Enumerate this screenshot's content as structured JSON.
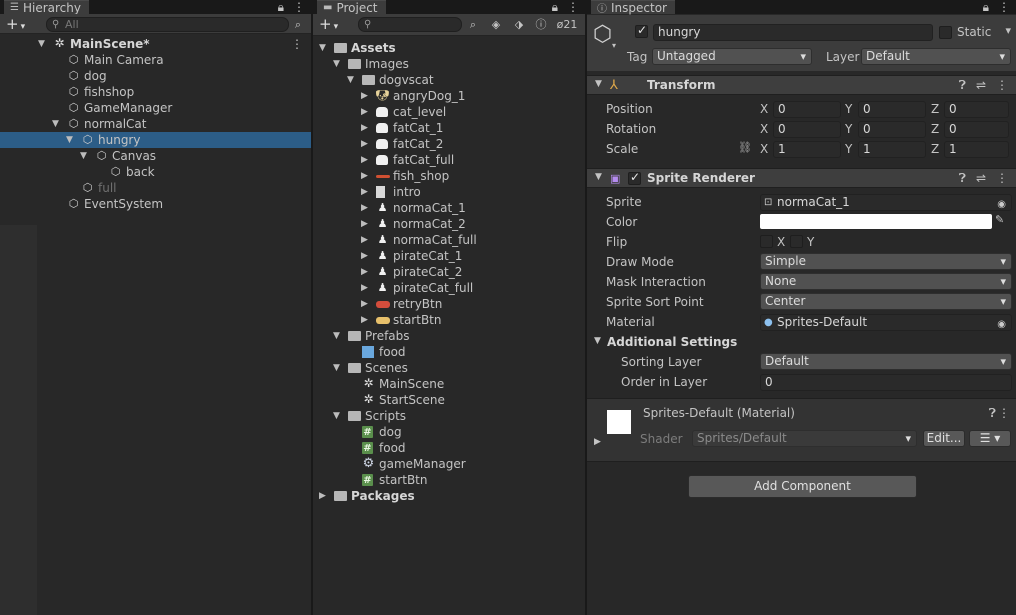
{
  "hierarchy": {
    "tab_label": "Hierarchy",
    "search_placeholder": "All",
    "items": [
      {
        "label": "MainScene*",
        "depth": 0,
        "icon": "unity-scene-icon",
        "bold": true,
        "arrow": "down",
        "kebab": true
      },
      {
        "label": "Main Camera",
        "depth": 1,
        "icon": "gameobject-cube-icon"
      },
      {
        "label": "dog",
        "depth": 1,
        "icon": "gameobject-cube-icon"
      },
      {
        "label": "fishshop",
        "depth": 1,
        "icon": "gameobject-cube-icon"
      },
      {
        "label": "GameManager",
        "depth": 1,
        "icon": "gameobject-cube-icon"
      },
      {
        "label": "normalCat",
        "depth": 1,
        "icon": "gameobject-cube-icon",
        "arrow": "down"
      },
      {
        "label": "hungry",
        "depth": 2,
        "icon": "gameobject-cube-icon",
        "arrow": "down",
        "selected": true
      },
      {
        "label": "Canvas",
        "depth": 3,
        "icon": "gameobject-cube-icon",
        "arrow": "down"
      },
      {
        "label": "back",
        "depth": 4,
        "icon": "gameobject-cube-icon"
      },
      {
        "label": "full",
        "depth": 2,
        "icon": "gameobject-cube-icon",
        "inactive": true
      },
      {
        "label": "EventSystem",
        "depth": 1,
        "icon": "gameobject-cube-icon"
      }
    ]
  },
  "project": {
    "tab_label": "Project",
    "hidden_count": "21",
    "items": [
      {
        "label": "Assets",
        "depth": 0,
        "icon": "folder-icon",
        "bold": true,
        "arrow": "down"
      },
      {
        "label": "Images",
        "depth": 1,
        "icon": "folder-icon",
        "arrow": "down"
      },
      {
        "label": "dogvscat",
        "depth": 2,
        "icon": "folder-icon",
        "arrow": "down"
      },
      {
        "label": "angryDog_1",
        "depth": 3,
        "icon": "sprite-dog-thumb",
        "arrow": "right"
      },
      {
        "label": "cat_level",
        "depth": 3,
        "icon": "sprite-white-thumb",
        "arrow": "right"
      },
      {
        "label": "fatCat_1",
        "depth": 3,
        "icon": "sprite-white-thumb",
        "arrow": "right"
      },
      {
        "label": "fatCat_2",
        "depth": 3,
        "icon": "sprite-white-thumb",
        "arrow": "right"
      },
      {
        "label": "fatCat_full",
        "depth": 3,
        "icon": "sprite-white-thumb",
        "arrow": "right"
      },
      {
        "label": "fish_shop",
        "depth": 3,
        "icon": "sprite-bar-thumb",
        "arrow": "right"
      },
      {
        "label": "intro",
        "depth": 3,
        "icon": "sprite-card-thumb",
        "arrow": "right"
      },
      {
        "label": "normaCat_1",
        "depth": 3,
        "icon": "sprite-cat-thumb",
        "arrow": "right"
      },
      {
        "label": "normaCat_2",
        "depth": 3,
        "icon": "sprite-cat-thumb",
        "arrow": "right"
      },
      {
        "label": "normaCat_full",
        "depth": 3,
        "icon": "sprite-cat-thumb",
        "arrow": "right"
      },
      {
        "label": "pirateCat_1",
        "depth": 3,
        "icon": "sprite-cat-thumb",
        "arrow": "right"
      },
      {
        "label": "pirateCat_2",
        "depth": 3,
        "icon": "sprite-cat-thumb",
        "arrow": "right"
      },
      {
        "label": "pirateCat_full",
        "depth": 3,
        "icon": "sprite-cat-thumb",
        "arrow": "right"
      },
      {
        "label": "retryBtn",
        "depth": 3,
        "icon": "sprite-red-button-thumb",
        "arrow": "right"
      },
      {
        "label": "startBtn",
        "depth": 3,
        "icon": "sprite-yellow-button-thumb",
        "arrow": "right"
      },
      {
        "label": "Prefabs",
        "depth": 1,
        "icon": "folder-icon",
        "arrow": "down"
      },
      {
        "label": "food",
        "depth": 2,
        "icon": "prefab-icon"
      },
      {
        "label": "Scenes",
        "depth": 1,
        "icon": "folder-icon",
        "arrow": "down"
      },
      {
        "label": "MainScene",
        "depth": 2,
        "icon": "unity-scene-icon"
      },
      {
        "label": "StartScene",
        "depth": 2,
        "icon": "unity-scene-icon"
      },
      {
        "label": "Scripts",
        "depth": 1,
        "icon": "folder-icon",
        "arrow": "down"
      },
      {
        "label": "dog",
        "depth": 2,
        "icon": "csharp-script-icon"
      },
      {
        "label": "food",
        "depth": 2,
        "icon": "csharp-script-icon"
      },
      {
        "label": "gameManager",
        "depth": 2,
        "icon": "gear-script-icon"
      },
      {
        "label": "startBtn",
        "depth": 2,
        "icon": "csharp-script-icon"
      },
      {
        "label": "Packages",
        "depth": 0,
        "icon": "folder-icon",
        "bold": true,
        "arrow": "right"
      }
    ]
  },
  "inspector": {
    "tab_label": "Inspector",
    "object_name": "hungry",
    "active": true,
    "static_label": "Static",
    "tag_label": "Tag",
    "tag_value": "Untagged",
    "layer_label": "Layer",
    "layer_value": "Default",
    "transform": {
      "title": "Transform",
      "position_label": "Position",
      "rotation_label": "Rotation",
      "scale_label": "Scale",
      "x": "X",
      "y": "Y",
      "z": "Z",
      "position": [
        "0",
        "0",
        "0"
      ],
      "rotation": [
        "0",
        "0",
        "0"
      ],
      "scale": [
        "1",
        "1",
        "1"
      ]
    },
    "sprite_renderer": {
      "title": "Sprite Renderer",
      "enabled": true,
      "sprite_label": "Sprite",
      "sprite_value": "normaCat_1",
      "color_label": "Color",
      "color_value": "#ffffff",
      "flip_label": "Flip",
      "flip_x": "X",
      "flip_y": "Y",
      "draw_mode_label": "Draw Mode",
      "draw_mode_value": "Simple",
      "mask_label": "Mask Interaction",
      "mask_value": "None",
      "sort_point_label": "Sprite Sort Point",
      "sort_point_value": "Center",
      "material_label": "Material",
      "material_value": "Sprites-Default",
      "additional_title": "Additional Settings",
      "sorting_layer_label": "Sorting Layer",
      "sorting_layer_value": "Default",
      "order_label": "Order in Layer",
      "order_value": "0"
    },
    "material": {
      "title": "Sprites-Default (Material)",
      "shader_label": "Shader",
      "shader_value": "Sprites/Default",
      "edit_label": "Edit..."
    },
    "add_component_label": "Add Component"
  },
  "colors": {
    "selection": "#2c5d87",
    "panel_bg": "#282828",
    "header_bg": "#3e3e3e"
  }
}
